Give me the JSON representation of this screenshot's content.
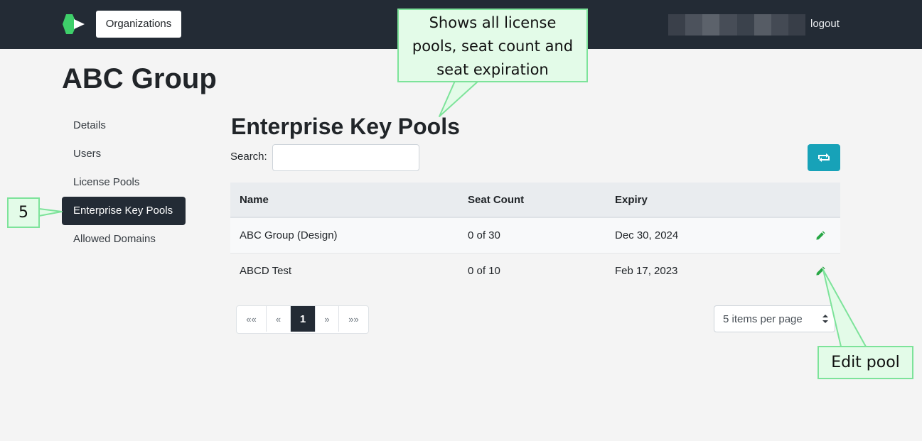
{
  "header": {
    "org_button": "Organizations",
    "logout": "logout",
    "user_blur_colors": [
      "#3a404a",
      "#4c525c",
      "#5c626b",
      "#474d57",
      "#3b424c",
      "#565c65",
      "#444a54",
      "#383e48"
    ]
  },
  "page": {
    "title": "ABC Group"
  },
  "sidebar": {
    "items": [
      {
        "label": "Details",
        "active": false
      },
      {
        "label": "Users",
        "active": false
      },
      {
        "label": "License Pools",
        "active": false
      },
      {
        "label": "Enterprise Key Pools",
        "active": true
      },
      {
        "label": "Allowed Domains",
        "active": false
      }
    ]
  },
  "main": {
    "title": "Enterprise Key Pools",
    "search_label": "Search:",
    "search_value": "",
    "refresh_icon": "refresh-icon",
    "columns": [
      "Name",
      "Seat Count",
      "Expiry",
      ""
    ],
    "rows": [
      {
        "name": "ABC Group (Design)",
        "seat_count": "0 of 30",
        "expiry": "Dec 30, 2024",
        "action_icon": "pencil-icon"
      },
      {
        "name": "ABCD Test",
        "seat_count": "0 of 10",
        "expiry": "Feb 17, 2023",
        "action_icon": "pencil-icon"
      }
    ],
    "pagination": {
      "first": "««",
      "prev": "«",
      "current": "1",
      "next": "»",
      "last": "»»"
    },
    "per_page": "5 items per page"
  },
  "annotations": {
    "main_callout": [
      "Shows all license",
      "pools, seat count and",
      "seat expiration"
    ],
    "step_number": "5",
    "edit_callout": "Edit pool"
  },
  "colors": {
    "header_bg": "#232b35",
    "accent_teal": "#17a2b8",
    "edit_green": "#28a745",
    "callout_fill": "#e3fbe8",
    "callout_border": "#7de39a"
  }
}
